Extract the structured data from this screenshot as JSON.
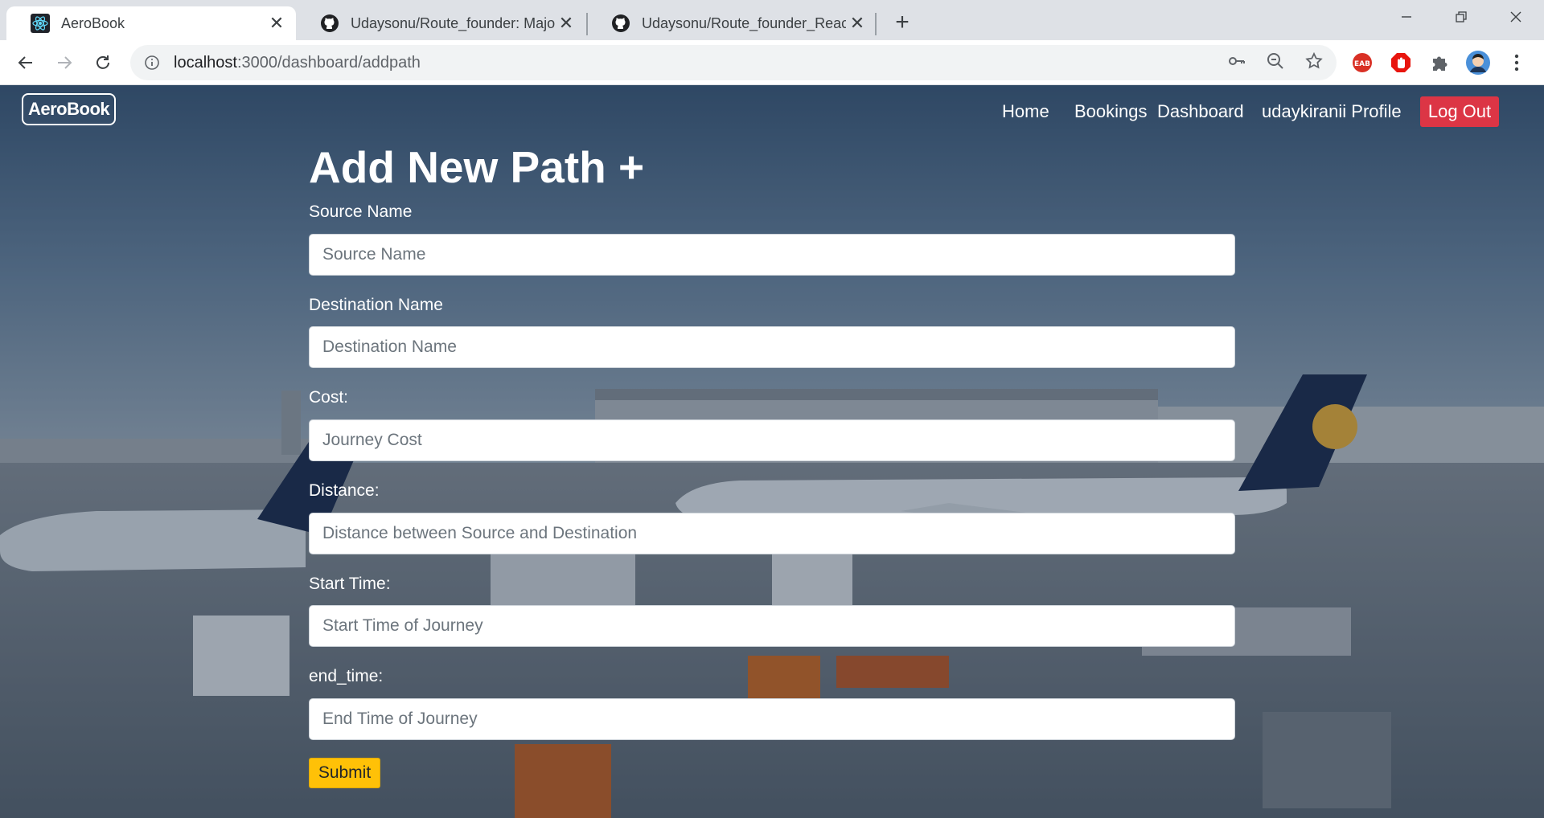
{
  "browser": {
    "tabs": [
      {
        "title": "AeroBook",
        "active": true,
        "icon": "react-icon"
      },
      {
        "title": "Udaysonu/Route_founder: Major",
        "active": false,
        "icon": "github-icon"
      },
      {
        "title": "Udaysonu/Route_founder_React_",
        "active": false,
        "icon": "github-icon"
      }
    ],
    "url_host": "localhost",
    "url_path": ":3000/dashboard/addpath"
  },
  "navbar": {
    "brand": "AeroBook",
    "links": {
      "home": "Home",
      "bookings": "Bookings",
      "dashboard": "Dashboard",
      "profile": "udaykiranii Profile"
    },
    "logout": "Log Out"
  },
  "form": {
    "title": "Add New Path +",
    "fields": [
      {
        "label": "Source Name",
        "placeholder": "Source Name"
      },
      {
        "label": "Destination Name",
        "placeholder": "Destination Name"
      },
      {
        "label": "Cost:",
        "placeholder": "Journey Cost"
      },
      {
        "label": "Distance:",
        "placeholder": "Distance between Source and Destination"
      },
      {
        "label": "Start Time:",
        "placeholder": "Start Time of Journey"
      },
      {
        "label": "end_time:",
        "placeholder": "End Time of Journey"
      }
    ],
    "submit": "Submit"
  },
  "colors": {
    "logout_bg": "#dc3545",
    "submit_bg": "#ffc107"
  }
}
